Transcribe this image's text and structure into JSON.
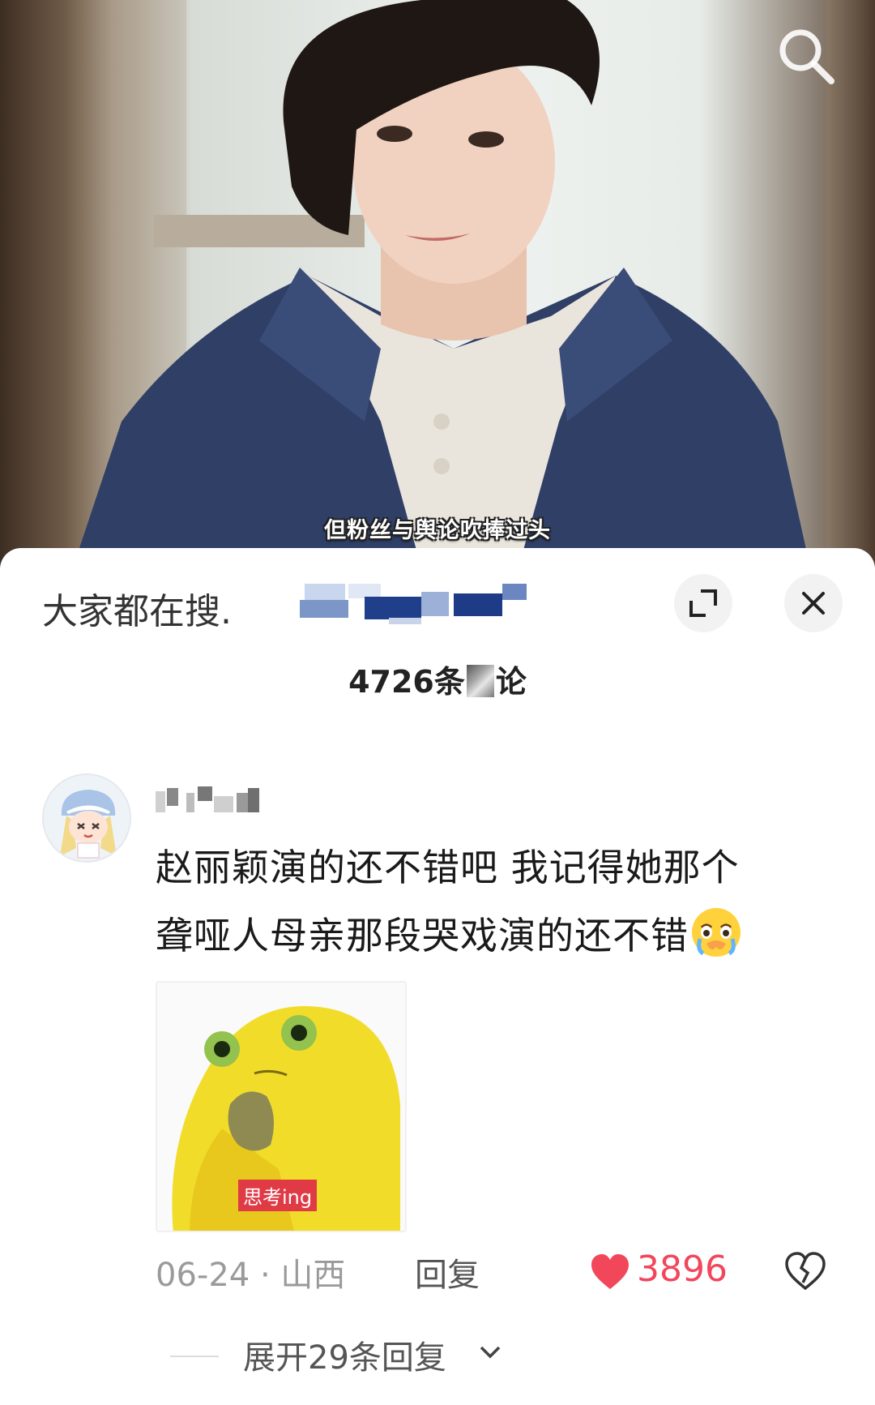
{
  "video": {
    "subtitle": "但粉丝与舆论吹捧过头",
    "search_icon": "search-icon"
  },
  "sheet": {
    "search_prefix": "大家都在搜.",
    "expand_icon": "expand-icon",
    "close_icon": "close-icon",
    "comment_count_prefix": "4726条",
    "comment_count_suffix": "论"
  },
  "comment": {
    "avatar": "anime-girl-avatar",
    "text_line1": "赵丽颖演的还不错吧  我记得她那个",
    "text_line2": "聋哑人母亲那段哭戏演的还不错",
    "emoji": "crying-face-emoji",
    "sticker_label": "思考ing",
    "date_location": "06-24 · 山西",
    "reply_label": "回复",
    "like_count": "3896",
    "expand_replies_label": "展开29条回复"
  },
  "colors": {
    "like_red": "#f2465b",
    "text_dark": "#1a1a1a",
    "text_gray": "#9a9a9a"
  }
}
